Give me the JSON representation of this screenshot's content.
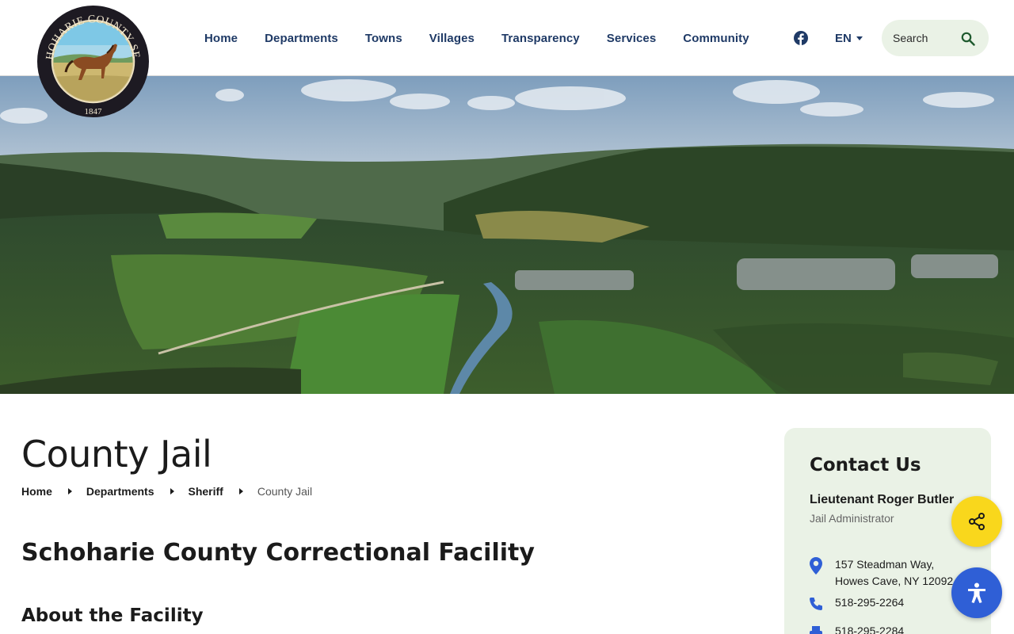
{
  "header": {
    "seal": {
      "top_text": "SCHOHARIE COUNTY SEAL",
      "year": "1847"
    },
    "nav": [
      {
        "label": "Home"
      },
      {
        "label": "Departments"
      },
      {
        "label": "Towns"
      },
      {
        "label": "Villages"
      },
      {
        "label": "Transparency"
      },
      {
        "label": "Services"
      },
      {
        "label": "Community"
      }
    ],
    "social_icon": "facebook-icon",
    "language": "EN",
    "search": {
      "placeholder": "Search",
      "icon": "search-icon"
    }
  },
  "page": {
    "title": "County Jail",
    "breadcrumb": [
      {
        "label": "Home"
      },
      {
        "label": "Departments"
      },
      {
        "label": "Sheriff"
      }
    ],
    "breadcrumb_current": "County Jail",
    "subtitle": "Schoharie County Correctional Facility",
    "section_heading": "About the Facility"
  },
  "contact": {
    "heading": "Contact Us",
    "name": "Lieutenant Roger Butler",
    "role": "Jail Administrator",
    "address_line1": "157 Steadman Way,",
    "address_line2": "Howes Cave, NY 12092",
    "phone": "518-295-2264",
    "fax": "518-295-2284"
  },
  "floating": {
    "share_icon": "share-icon",
    "accessibility_icon": "accessibility-icon"
  },
  "colors": {
    "nav_text": "#1f3a66",
    "card_bg": "#eaf2e6",
    "accent_blue": "#2f5fd6",
    "share_yellow": "#f9d71c"
  }
}
